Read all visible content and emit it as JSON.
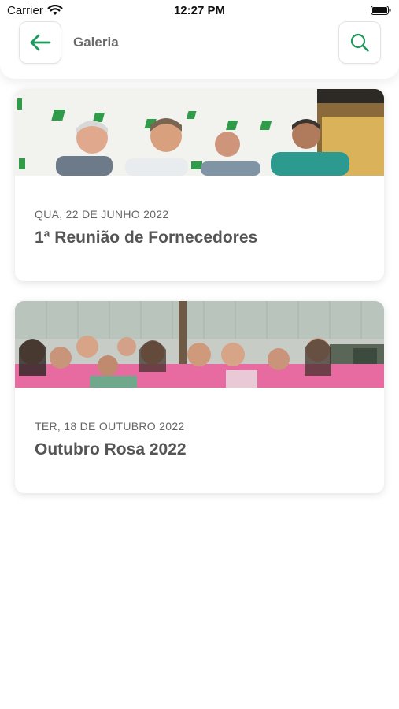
{
  "status_bar": {
    "carrier": "Carrier",
    "time": "12:27 PM"
  },
  "header": {
    "title": "Galeria",
    "back_icon": "arrow-left-icon",
    "search_icon": "search-icon"
  },
  "colors": {
    "accent": "#1e9a5c",
    "card_title": "#555555",
    "card_date": "#666666"
  },
  "gallery": [
    {
      "date": "QUA, 22 DE JUNHO 2022",
      "title": "1ª Reunião de Fornecedores"
    },
    {
      "date": "TER, 18 DE OUTUBRO 2022",
      "title": "Outubro Rosa 2022"
    }
  ]
}
